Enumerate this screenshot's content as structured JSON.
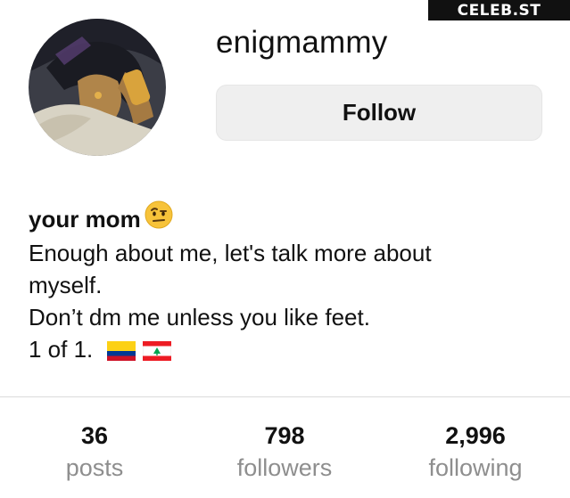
{
  "watermark": "CELEB.ST",
  "profile": {
    "username": "enigmammy",
    "follow_label": "Follow"
  },
  "bio": {
    "name": "your mom",
    "name_emoji": "raised-eyebrow-face-icon",
    "lines": [
      "Enough about me, let's talk more about",
      "myself.",
      "Don’t dm me unless you like feet.",
      "1 of 1."
    ],
    "flags": [
      "colombia-flag-icon",
      "lebanon-flag-icon"
    ]
  },
  "stats": [
    {
      "value": "36",
      "label": "posts"
    },
    {
      "value": "798",
      "label": "followers"
    },
    {
      "value": "2,996",
      "label": "following"
    }
  ],
  "colors": {
    "button_bg": "#efefef",
    "label_gray": "#8e8e8e",
    "divider": "#dadada"
  }
}
